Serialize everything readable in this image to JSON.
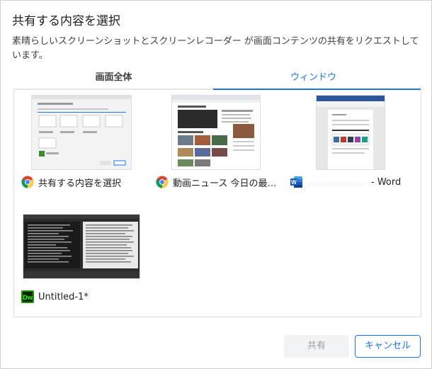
{
  "dialog": {
    "title": "共有する内容を選択",
    "description": "素晴らしいスクリーンショットとスクリーンレコーダー が画面コンテンツの共有をリクエストしています。"
  },
  "tabs": {
    "entire_screen": "画面全体",
    "window": "ウィンドウ"
  },
  "windows": [
    {
      "label": "共有する内容を選択",
      "icon": "chrome-icon"
    },
    {
      "label": "動画ニュース 今日の最…",
      "icon": "chrome-icon"
    },
    {
      "label_blurred": "………………",
      "label": "- Word",
      "icon": "word-icon"
    },
    {
      "label": "Untitled-1*",
      "icon": "dreamweaver-icon",
      "icon_text": "Dw"
    }
  ],
  "buttons": {
    "share": "共有",
    "cancel": "キャンセル"
  },
  "colors": {
    "accent": "#1a73e8",
    "disabled_bg": "#f1f3f4",
    "disabled_text": "#9aa0a6"
  }
}
